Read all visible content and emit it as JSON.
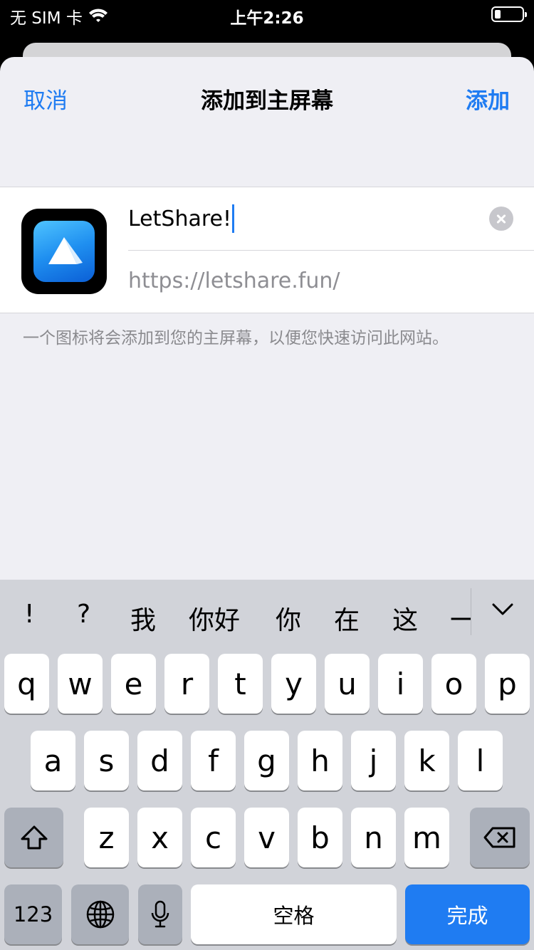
{
  "status_bar": {
    "carrier": "无 SIM 卡",
    "time": "上午2:26"
  },
  "nav": {
    "cancel_label": "取消",
    "title": "添加到主屏幕",
    "add_label": "添加"
  },
  "form": {
    "name_value": "LetShare!",
    "url": "https://letshare.fun/",
    "hint": "一个图标将会添加到您的主屏幕，以便您快速访问此网站。"
  },
  "keyboard": {
    "candidates": [
      "!",
      "?",
      "我",
      "你好",
      "你",
      "在",
      "这",
      "一"
    ],
    "row1": [
      "q",
      "w",
      "e",
      "r",
      "t",
      "y",
      "u",
      "i",
      "o",
      "p"
    ],
    "row2": [
      "a",
      "s",
      "d",
      "f",
      "g",
      "h",
      "j",
      "k",
      "l"
    ],
    "row3": [
      "z",
      "x",
      "c",
      "v",
      "b",
      "n",
      "m"
    ],
    "numbers_label": "123",
    "space_label": "空格",
    "done_label": "完成"
  }
}
